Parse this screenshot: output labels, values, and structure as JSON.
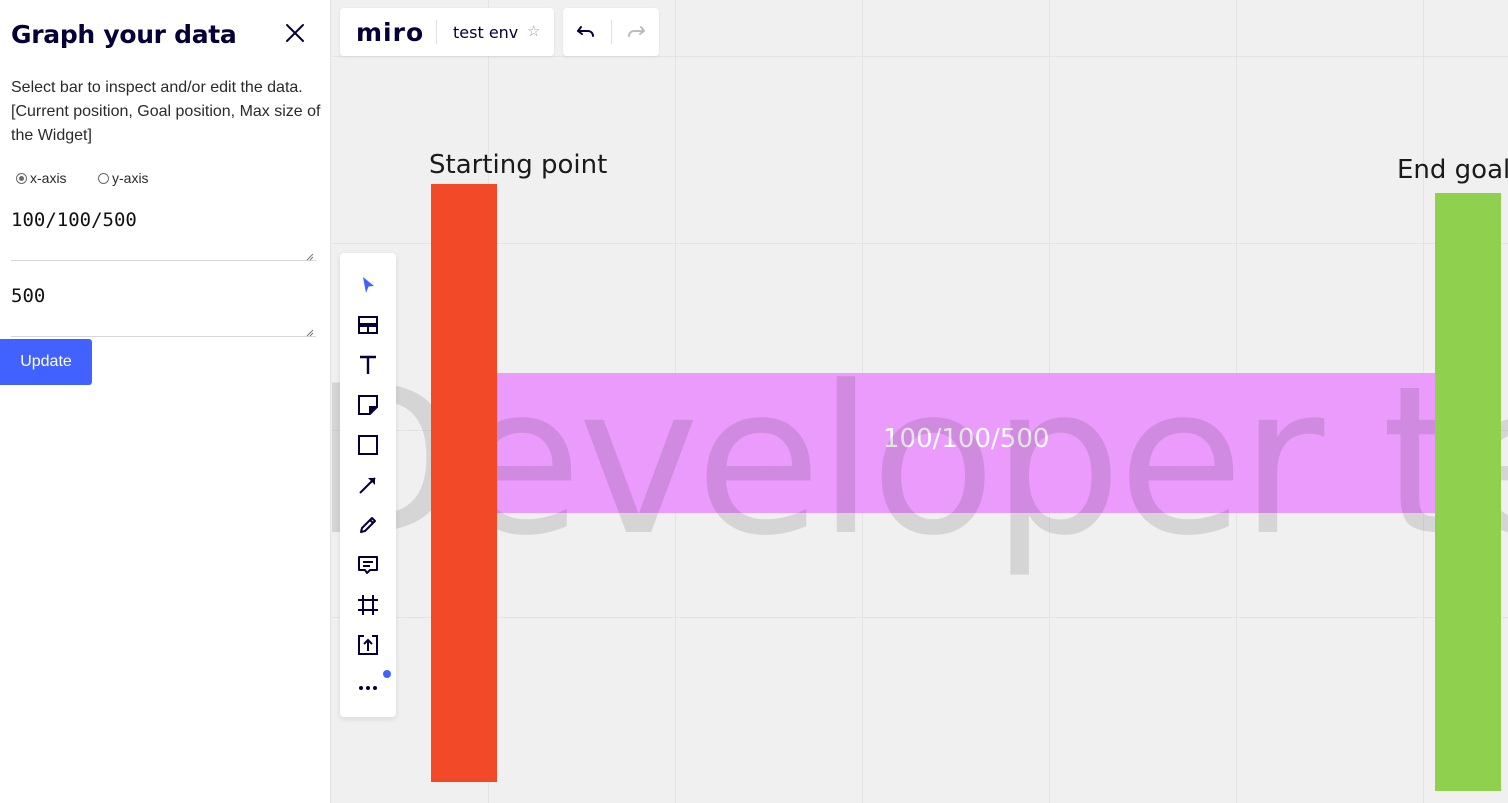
{
  "panel": {
    "title": "Graph your data",
    "description": "Select bar to inspect and/or edit the data. [Current position, Goal position, Max size of the Widget]",
    "axis_options": [
      "x-axis",
      "y-axis"
    ],
    "selected_axis": "x-axis",
    "data_field_value": "100/100/500",
    "max_field_value": "500",
    "update_label": "Update"
  },
  "topbar": {
    "logo": "miro",
    "board_name": "test env"
  },
  "toolbar": {
    "tools": [
      "select-icon",
      "templates-icon",
      "text-icon",
      "sticky-note-icon",
      "shape-icon",
      "arrow-icon",
      "pen-icon",
      "comment-icon",
      "frame-icon",
      "upload-icon",
      "more-icon"
    ]
  },
  "board": {
    "watermark": "Developer tea",
    "start_label": "Starting point",
    "end_label": "End goal",
    "range_label": "100/100/500",
    "colors": {
      "start_bar": "#f24a29",
      "range_bar": "#ea9bfb",
      "end_bar": "#8fd14f",
      "accent": "#4262ff"
    },
    "progress": {
      "current": 100,
      "goal": 100,
      "max": 500
    }
  }
}
